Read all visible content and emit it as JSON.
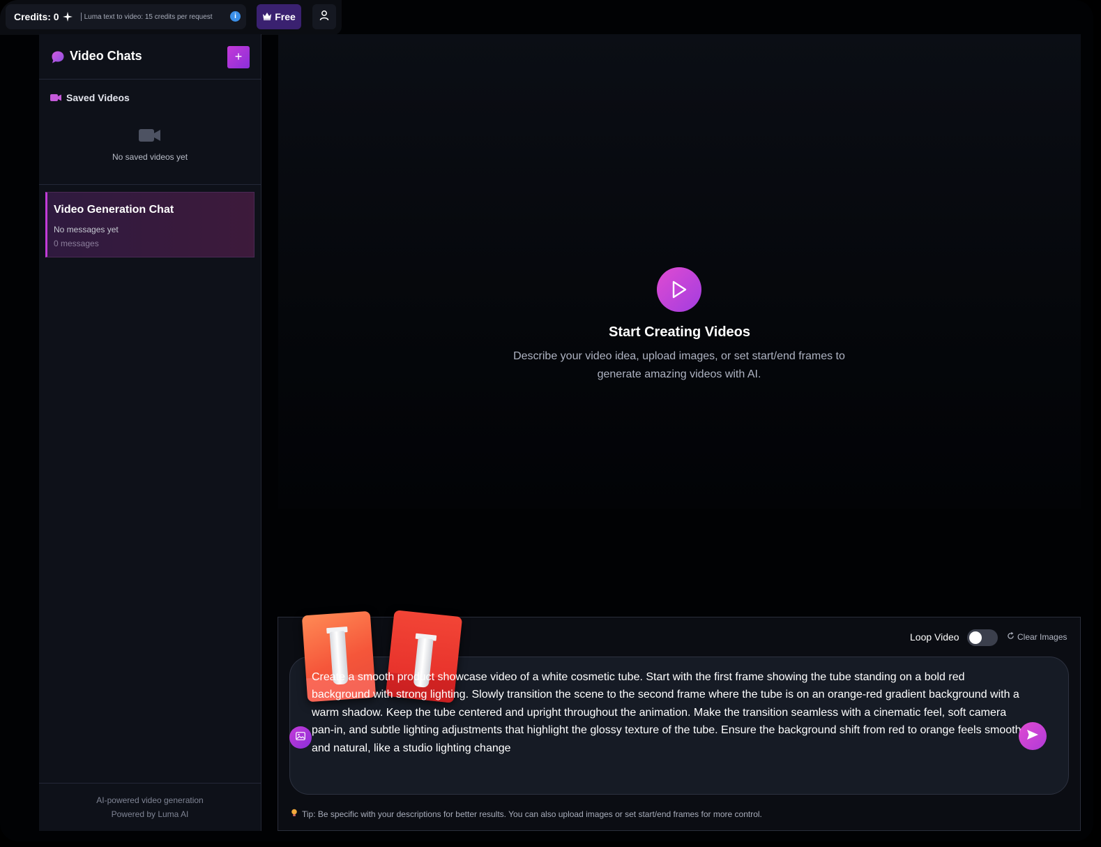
{
  "topbar": {
    "credits_label": "Credits: 0",
    "credits_note": "Luma text to video: 15 credits per request",
    "plan_label": "Free"
  },
  "sidebar": {
    "title": "Video Chats",
    "new_chat_label": "+",
    "saved_heading": "Saved Videos",
    "saved_empty": "No saved videos yet",
    "chats": [
      {
        "title": "Video Generation Chat",
        "preview": "No messages yet",
        "count": "0 messages"
      }
    ],
    "footer_line1": "AI-powered video generation",
    "footer_line2": "Powered by Luma AI"
  },
  "main": {
    "empty_title": "Start Creating Videos",
    "empty_desc": "Describe your video idea, upload images, or set start/end frames to generate amazing videos with AI."
  },
  "composer": {
    "loop_label": "Loop Video",
    "loop_on": false,
    "clear_images_label": "Clear Images",
    "prompt": "Create a smooth product showcase video of a white cosmetic tube. Start with the first frame showing the tube standing on a bold red background with strong lighting. Slowly transition the scene to the second frame where the tube is on an orange-red gradient background with a warm shadow. Keep the tube centered and upright throughout the animation. Make the transition seamless with a cinematic feel, soft camera pan-in, and subtle lighting adjustments that highlight the glossy texture of the tube. Ensure the background shift from red to orange feels smooth and natural, like a studio lighting change",
    "tip": "Tip: Be specific with your descriptions for better results. You can also upload images or set start/end frames for more control."
  },
  "colors": {
    "accent": "#c43ad8",
    "accent_alt": "#8b2fd9",
    "plan_badge": "#3a2170",
    "background": "#010204"
  },
  "icons": [
    "sparkle-icon",
    "info-icon",
    "crown-icon",
    "user-icon",
    "chat-bubble-icon",
    "video-camera-icon",
    "play-icon",
    "refresh-icon",
    "image-icon",
    "send-icon",
    "lightbulb-icon"
  ]
}
